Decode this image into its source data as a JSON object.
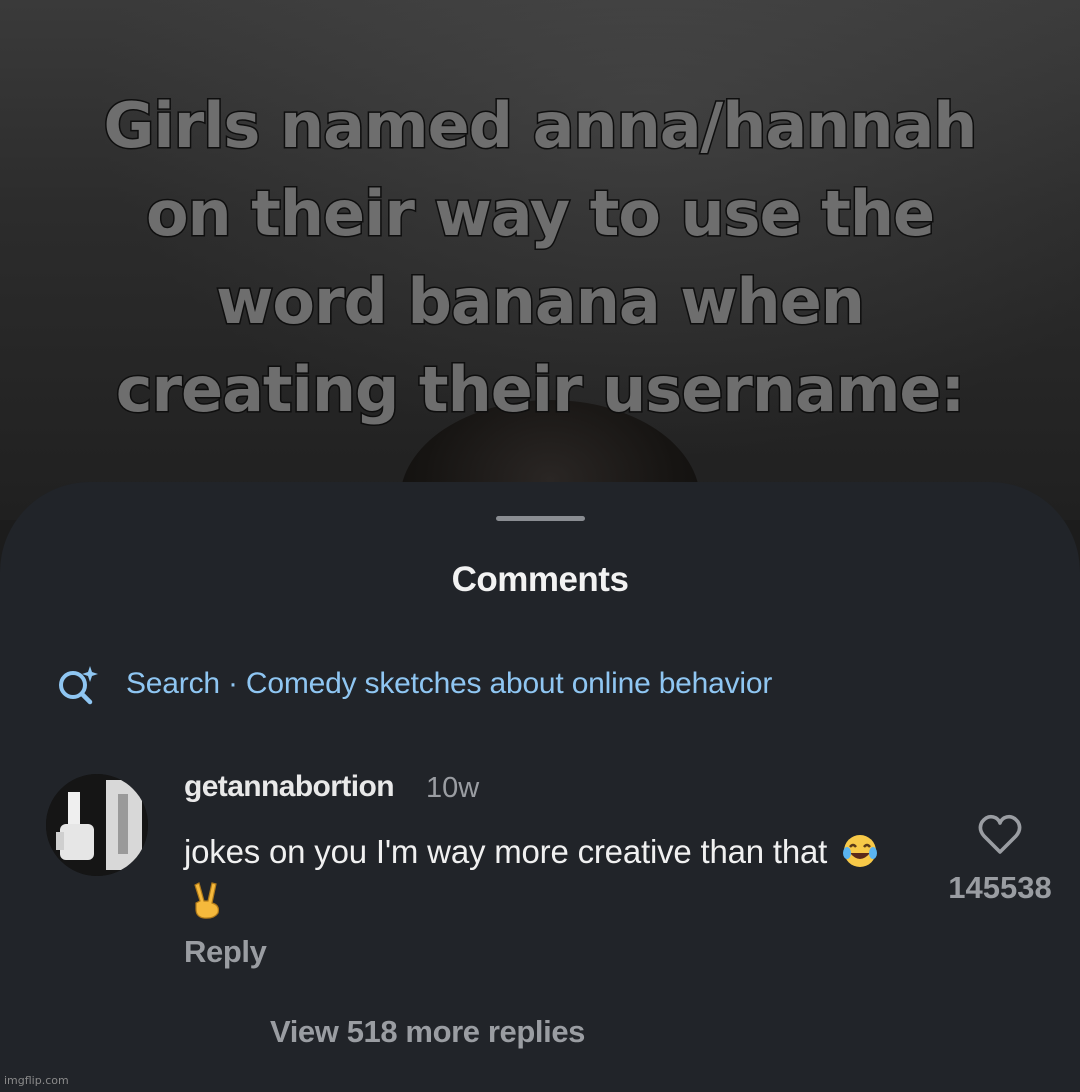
{
  "video": {
    "overlay_lines": [
      "Girls named anna/hannah",
      "on their way to use the",
      "word banana when",
      "creating their username:"
    ]
  },
  "sheet": {
    "title": "Comments",
    "search": {
      "icon": "search-sparkle-icon",
      "text": "Search · Comedy sketches about online behavior",
      "color": "#8fc6f2"
    },
    "comment": {
      "username": "getannabortion",
      "time": "10w",
      "text": "jokes on you I'm way more creative than that",
      "emojis": [
        "😂",
        "✌️"
      ],
      "reply_label": "Reply",
      "like_icon": "heart-outline-icon",
      "like_count": "145538",
      "view_replies_label": "View 518 more replies"
    }
  },
  "watermark": "imgflip.com",
  "colors": {
    "sheet_bg": "#212429",
    "secondary_text": "#9a9da2",
    "primary_text": "#f0f0f0"
  }
}
